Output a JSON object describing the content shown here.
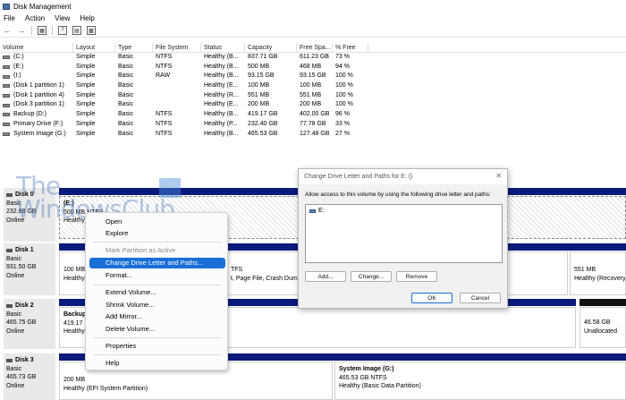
{
  "window": {
    "title": "Disk Management"
  },
  "menu": [
    "File",
    "Action",
    "View",
    "Help"
  ],
  "toolbar": {
    "icons": [
      "back-arrow-icon",
      "forward-arrow-icon",
      "console-tree-icon",
      "help-icon",
      "properties-icon",
      "view-icon"
    ]
  },
  "volumes": {
    "headers": [
      "Volume",
      "Layout",
      "Type",
      "File System",
      "Status",
      "Capacity",
      "Free Spa...",
      "% Free"
    ],
    "rows": [
      [
        "(C:)",
        "Simple",
        "Basic",
        "NTFS",
        "Healthy (B...",
        "837.71 GB",
        "611.23 GB",
        "73 %"
      ],
      [
        "(E:)",
        "Simple",
        "Basic",
        "NTFS",
        "Healthy (B...",
        "500 MB",
        "468 MB",
        "94 %"
      ],
      [
        "(I:)",
        "Simple",
        "Basic",
        "RAW",
        "Healthy (B...",
        "93.15 GB",
        "93.15 GB",
        "100 %"
      ],
      [
        "(Disk 1 partition 1)",
        "Simple",
        "Basic",
        "",
        "Healthy (E...",
        "100 MB",
        "100 MB",
        "100 %"
      ],
      [
        "(Disk 1 partition 4)",
        "Simple",
        "Basic",
        "",
        "Healthy (R...",
        "551 MB",
        "551 MB",
        "100 %"
      ],
      [
        "(Disk 3 partition 1)",
        "Simple",
        "Basic",
        "",
        "Healthy (E...",
        "200 MB",
        "200 MB",
        "100 %"
      ],
      [
        "Backup (D:)",
        "Simple",
        "Basic",
        "NTFS",
        "Healthy (B...",
        "419.17 GB",
        "402.00 GB",
        "96 %"
      ],
      [
        "Primary Drive (F:)",
        "Simple",
        "Basic",
        "NTFS",
        "Healthy (P...",
        "232.40 GB",
        "77.78 GB",
        "33 %"
      ],
      [
        "System Image (G:)",
        "Simple",
        "Basic",
        "NTFS",
        "Healthy (B...",
        "465.53 GB",
        "127.48 GB",
        "27 %"
      ]
    ]
  },
  "watermark": {
    "line1": "The",
    "line2": "WindowsClub"
  },
  "disks": [
    {
      "name": "Disk 0",
      "type": "Basic",
      "size": "232.88 GB",
      "status": "Online",
      "partitions": [
        {
          "name": "(E:)",
          "line2": "500 MB NTFS",
          "line3": "Healthy"
        }
      ]
    },
    {
      "name": "Disk 1",
      "type": "Basic",
      "size": "931.50 GB",
      "status": "Online",
      "partitions": [
        {
          "line2": "100 MB",
          "line3": "Healthy"
        },
        {
          "line2": "TFS",
          "line3": "t, Page File, Crash Dum"
        },
        {
          "line2": "551 MB",
          "line3": "Healthy (Recovery"
        }
      ]
    },
    {
      "name": "Disk 2",
      "type": "Basic",
      "size": "465.75 GB",
      "status": "Online",
      "partitions": [
        {
          "name": "Backup",
          "line2": "419.17",
          "line3": "Healthy"
        },
        {
          "line2": "46.58 GB",
          "line3": "Unallocated"
        }
      ]
    },
    {
      "name": "Disk 3",
      "type": "Basic",
      "size": "465.73 GB",
      "status": "Online",
      "partitions": [
        {
          "line2": "200 MB",
          "line3": "Healthy (EFI System Partition)"
        },
        {
          "name": "System Image  (G:)",
          "line2": "465.53 GB NTFS",
          "line3": "Healthy (Basic Data Partition)"
        }
      ]
    }
  ],
  "context_menu": {
    "items": [
      {
        "label": "Open",
        "state": "normal"
      },
      {
        "label": "Explore",
        "state": "normal"
      },
      {
        "label": "Mark Partition as Active",
        "state": "disabled"
      },
      {
        "label": "Change Drive Letter and Paths...",
        "state": "active"
      },
      {
        "label": "Format...",
        "state": "normal"
      },
      {
        "label": "Extend Volume...",
        "state": "normal"
      },
      {
        "label": "Shrink Volume...",
        "state": "normal"
      },
      {
        "label": "Add Mirror...",
        "state": "normal"
      },
      {
        "label": "Delete Volume...",
        "state": "normal"
      },
      {
        "label": "Properties",
        "state": "normal"
      },
      {
        "label": "Help",
        "state": "normal"
      }
    ]
  },
  "dialog": {
    "title": "Change Drive Letter and Paths for E: ()",
    "close_glyph": "✕",
    "description": "Allow access to this volume by using the following drive letter and paths:",
    "list_items": [
      "E:"
    ],
    "add_label": "Add...",
    "change_label": "Change...",
    "remove_label": "Remove",
    "ok_label": "OK",
    "cancel_label": "Cancel"
  },
  "colors": {
    "partition_bar": "#0b1a7b",
    "unallocated_bar": "#111111",
    "menu_highlight": "#1a6fd6"
  }
}
